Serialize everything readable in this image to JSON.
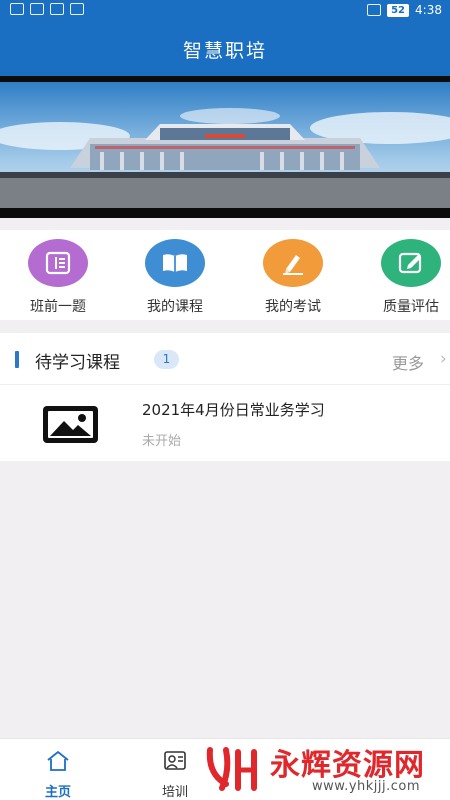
{
  "status_bar": {
    "battery": "52",
    "time": "4:38"
  },
  "app_bar": {
    "title": "智慧职培"
  },
  "quick_actions": [
    {
      "label": "班前一题",
      "icon": "ticket-icon",
      "color": "#b56cd0"
    },
    {
      "label": "我的课程",
      "icon": "book-icon",
      "color": "#3f8ed4"
    },
    {
      "label": "我的考试",
      "icon": "pen-icon",
      "color": "#f29b3a"
    },
    {
      "label": "质量评估",
      "icon": "edit-note-icon",
      "color": "#2fb37c"
    }
  ],
  "pending_courses": {
    "title": "待学习课程",
    "count": "1",
    "more_label": "更多",
    "items": [
      {
        "title": "2021年4月份日常业务学习",
        "status": "未开始",
        "thumb_icon": "image-placeholder-icon"
      }
    ]
  },
  "tab_bar": {
    "tabs": [
      {
        "label": "主页",
        "icon": "home-icon",
        "active": true
      },
      {
        "label": "培训",
        "icon": "training-icon",
        "active": false
      }
    ],
    "active_color": "#1a6fc2"
  },
  "watermark": {
    "logo_text": "永辉资源网",
    "url": "www.yhkjjj.com"
  },
  "colors": {
    "primary": "#1a6fc2",
    "background": "#f1eff1"
  }
}
